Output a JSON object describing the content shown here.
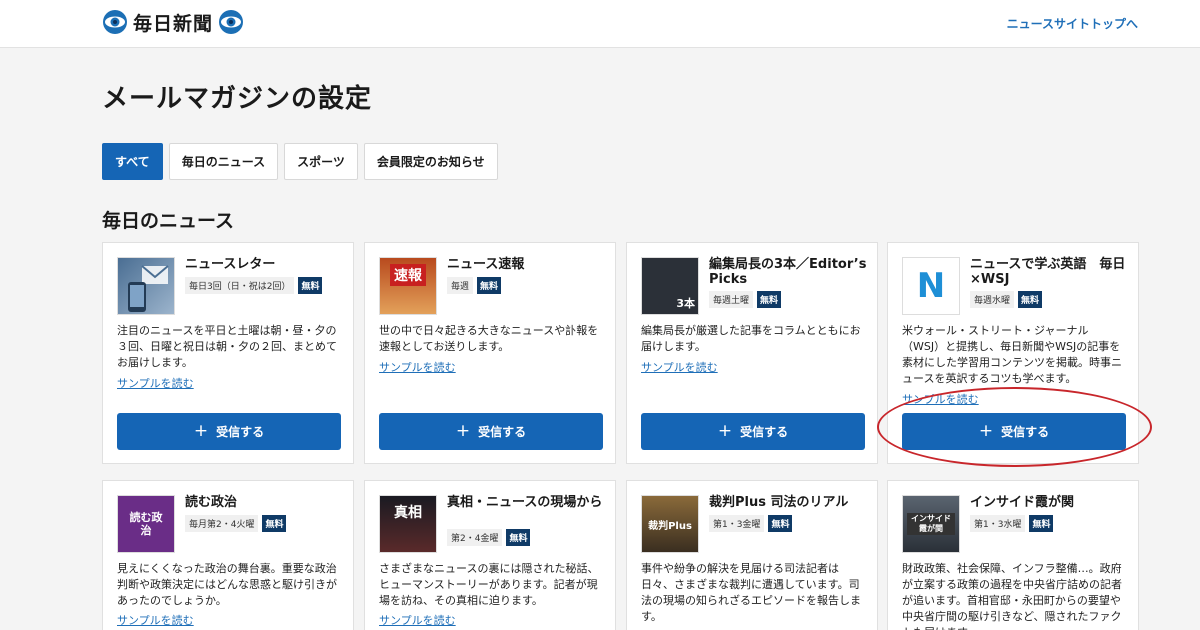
{
  "header": {
    "logo_text": "毎日新聞",
    "top_link": "ニュースサイトトップへ"
  },
  "page": {
    "title": "メールマガジンの設定",
    "section_title": "毎日のニュース"
  },
  "tabs": [
    {
      "label": "すべて",
      "active": true
    },
    {
      "label": "毎日のニュース",
      "active": false
    },
    {
      "label": "スポーツ",
      "active": false
    },
    {
      "label": "会員限定のお知らせ",
      "active": false
    }
  ],
  "cards": [
    {
      "title": "ニュースレター",
      "freq": "毎日3回（日・祝は2回）",
      "badge": "無料",
      "desc": "注目のニュースを平日と土曜は朝・昼・夕の３回、日曜と祝日は朝・夕の２回、まとめてお届けします。",
      "sample": "サンプルを読む",
      "button": "受信する",
      "thumb_icon": "mail-phone-icon"
    },
    {
      "title": "ニュース速報",
      "freq": "毎週",
      "badge": "無料",
      "desc": "世の中で日々起きる大きなニュースや訃報を速報としてお送りします。",
      "sample": "サンプルを読む",
      "button": "受信する",
      "thumb_text": "速報"
    },
    {
      "title": "編集局長の3本／Editor’s Picks",
      "freq": "毎週土曜",
      "badge": "無料",
      "desc": "編集局長が厳選した記事をコラムとともにお届けします。",
      "sample": "サンプルを読む",
      "button": "受信する",
      "thumb_text": "3本"
    },
    {
      "title": "ニュースで学ぶ英語　毎日×WSJ",
      "freq": "毎週水曜",
      "badge": "無料",
      "desc": "米ウォール・ストリート・ジャーナル（WSJ）と提携し、毎日新聞やWSJの記事を素材にした学習用コンテンツを掲載。時事ニュースを英訳するコツも学べます。",
      "sample": "サンプルを読む",
      "button": "受信する",
      "thumb_text": "N"
    },
    {
      "title": "読む政治",
      "freq": "毎月第2・4火曜",
      "badge": "無料",
      "desc": "見えにくくなった政治の舞台裏。重要な政治判断や政策決定にはどんな思惑と駆け引きがあったのでしょうか。",
      "sample": "サンプルを読む",
      "thumb_text": "読む政治"
    },
    {
      "title": "真相・ニュースの現場から",
      "freq": "第2・4金曜",
      "badge": "無料",
      "desc": "さまざまなニュースの裏には隠された秘話、ヒューマンストーリーがあります。記者が現場を訪ね、その真相に迫ります。",
      "sample": "サンプルを読む",
      "thumb_text": "真相"
    },
    {
      "title": "裁判Plus 司法のリアル",
      "freq": "第1・3金曜",
      "badge": "無料",
      "desc": "事件や紛争の解決を見届ける司法記者は日々、さまざまな裁判に遭遇しています。司法の現場の知られざるエピソードを報告します。",
      "thumb_text": "裁判Plus"
    },
    {
      "title": "インサイド霞が関",
      "freq": "第1・3水曜",
      "badge": "無料",
      "desc": "財政政策、社会保障、インフラ整備…。政府が立案する政策の過程を中央省庁詰めの記者が追います。首相官邸・永田町からの要望や中央省庁間の駆け引きなど、隠されたファクトも届けます。",
      "thumb_text": "インサイド霞が関"
    }
  ]
}
